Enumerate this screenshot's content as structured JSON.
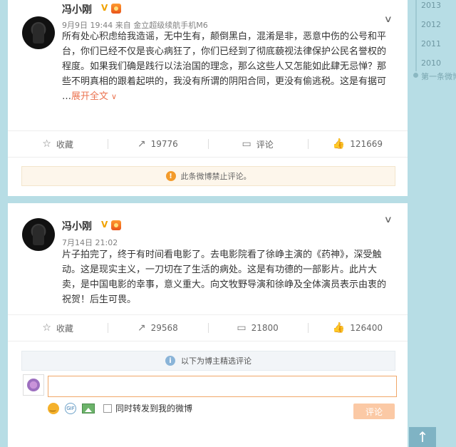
{
  "timeline": {
    "years": [
      "2013",
      "2012",
      "2011",
      "2010"
    ],
    "first_post": "第一条微博"
  },
  "posts": [
    {
      "author": "冯小刚",
      "verified_badge": "V",
      "time": "9月9日 19:44",
      "source_prefix": "来自",
      "source": "金立超级续航手机M6",
      "text_lines": [
        "所有处心积虑给我造谣，无中生有，颠倒黑白，混淆是非，恶意中伤的公号和平",
        "台，你们已经不仅是丧心病狂了，你们已经到了彻底藐视法律保护公民名誉权的",
        "程度。如果我们确是践行以法治国的理念，那么这些人又怎能如此肆无忌惮？那",
        "些不明真相的跟着起哄的，我没有所谓的阴阳合同，更没有偷逃税。这是有据可"
      ],
      "ellipsis": "…",
      "expand_label": "展开全文",
      "actions": {
        "favorite": "收藏",
        "repost": "19776",
        "comment": "评论",
        "like": "121669"
      },
      "notice": "此条微博禁止评论。"
    },
    {
      "author": "冯小刚",
      "verified_badge": "V",
      "time": "7月14日 21:02",
      "text_lines": [
        "片子拍完了，终于有时间看电影了。去电影院看了徐峥主演的《药神》，深受触",
        "动。这是现实主义，一刀切在了生活的病处。这是有功德的一部影片。此片大",
        "卖，是中国电影的幸事，意义重大。向文牧野导演和徐峥及全体演员表示由衷的",
        "祝贺！后生可畏。"
      ],
      "actions": {
        "favorite": "收藏",
        "repost": "29568",
        "comment": "21800",
        "like": "126400"
      },
      "selected_comments": "以下为博主精选评论",
      "comment_input": {
        "value": "",
        "placeholder": ""
      },
      "forward_label": "同时转发到我的微博",
      "submit_label": "评论"
    }
  ],
  "icons": {
    "star": "☆",
    "repost": "↗",
    "comment": "▭",
    "like": "👍",
    "caret": "∨",
    "top": "↑"
  },
  "colors": {
    "accent": "#eb7350",
    "background": "#b7dde5"
  }
}
